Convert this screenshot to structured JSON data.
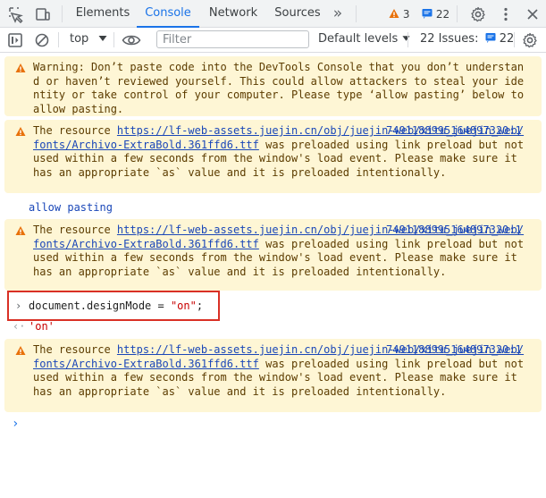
{
  "tabbar": {
    "tabs": [
      {
        "label": "Elements"
      },
      {
        "label": "Console"
      },
      {
        "label": "Network"
      },
      {
        "label": "Sources"
      }
    ],
    "more_tabs": "»",
    "warnings_count": "3",
    "messages_count": "22"
  },
  "toolbar": {
    "context": "top",
    "filter_placeholder": "Filter",
    "levels": "Default levels",
    "issues_label": "22 Issues:",
    "issues_count": "22"
  },
  "console": {
    "paste_warning": "Warning: Don’t paste code into the DevTools Console that you don’t understand or haven’t reviewed yourself. This could allow attackers to steal your identity or take control of your computer. Please type ‘allow pasting’ below to allow pasting.",
    "preload_prefix": "The resource ",
    "preload_url": "https://lf-web-assets.juejin.cn/obj/juejin-web/xitu_juejin_web/fonts/Archivo-ExtraBold.361ffd6.ttf",
    "preload_source": "7491188995164897320:1",
    "preload_suffix": " was preloaded using link preload but not used within a few seconds from the window's load event. Please make sure it has an appropriate `as` value and it is preloaded intentionally.",
    "allow_pasting": "allow pasting",
    "command_text": "document.designMode = ",
    "command_value": "\"on\"",
    "command_end": ";",
    "result": "'on'"
  },
  "colors": {
    "accent": "#1a73e8",
    "warning_bg": "#fef6d5",
    "warning_text": "#5c3c00",
    "highlight_box": "#d93025",
    "string_value": "#c80000"
  }
}
